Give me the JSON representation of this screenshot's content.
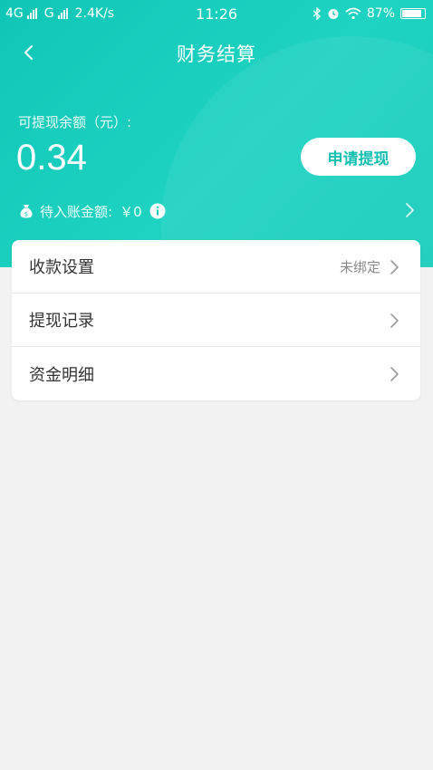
{
  "status_bar": {
    "network1": "4G",
    "network2": "G",
    "speed": "2.4K/s",
    "time": "11:26",
    "battery": "87%"
  },
  "nav": {
    "title": "财务结算",
    "back_icon": "chevron-left-icon"
  },
  "balance": {
    "label": "可提现余额（元）:",
    "amount": "0.34",
    "withdraw_button": "申请提现"
  },
  "pending": {
    "label": "待入账金额:",
    "amount": "￥0"
  },
  "menu": {
    "items": [
      {
        "label": "收款设置",
        "value": "未绑定"
      },
      {
        "label": "提现记录",
        "value": ""
      },
      {
        "label": "资金明细",
        "value": ""
      }
    ]
  },
  "colors": {
    "accent": "#17cdbb",
    "button_text": "#12bfb0",
    "background": "#f2f2f2"
  }
}
